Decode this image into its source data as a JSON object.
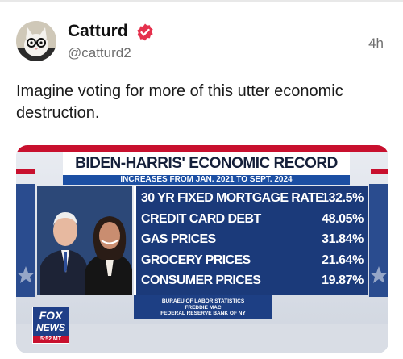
{
  "post": {
    "author_name": "Catturd",
    "handle": "@catturd2",
    "timestamp": "4h",
    "text": "Imagine voting for more of this utter economic destruction.",
    "avatar_icon": "cat-with-glasses-avatar",
    "verified_icon": "verified-badge-icon",
    "verified_color": "#e5314d"
  },
  "graphic": {
    "title": "BIDEN-HARRIS' ECONOMIC RECORD",
    "subtitle": "INCREASES FROM JAN. 2021 TO SEPT. 2024",
    "stats": [
      {
        "label": "30 YR FIXED MORTGAGE RATE",
        "value": "132.5%"
      },
      {
        "label": "CREDIT CARD DEBT",
        "value": "48.05%"
      },
      {
        "label": "GAS PRICES",
        "value": "31.84%"
      },
      {
        "label": "GROCERY PRICES",
        "value": "21.64%"
      },
      {
        "label": "CONSUMER PRICES",
        "value": "19.87%"
      }
    ],
    "sources": [
      "BURAEU OF LABOR STATISTICS",
      "FREDDIE MAC",
      "FEDERAL RESERVE BANK OF NY"
    ],
    "network_logo": {
      "line1": "FOX",
      "line2": "NEWS",
      "time": "5:52 MT"
    },
    "colors": {
      "panel_blue": "#1b3a7a",
      "accent_blue": "#1c4fa3",
      "accent_red": "#c8102e"
    }
  }
}
